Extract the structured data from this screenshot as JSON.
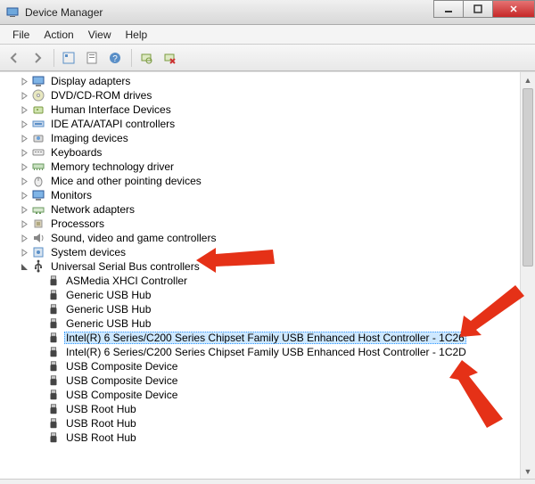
{
  "window": {
    "title": "Device Manager"
  },
  "menu": {
    "file": "File",
    "action": "Action",
    "view": "View",
    "help": "Help"
  },
  "toolbar": {
    "back": "Back",
    "forward": "Forward",
    "up": "Show hidden",
    "console": "Console tree",
    "properties": "Properties",
    "help": "Help",
    "scan": "Scan for hardware changes",
    "uninstall": "Uninstall"
  },
  "tree": {
    "categories": [
      {
        "name": "Display adapters",
        "icon": "monitor",
        "expanded": false
      },
      {
        "name": "DVD/CD-ROM drives",
        "icon": "disc",
        "expanded": false
      },
      {
        "name": "Human Interface Devices",
        "icon": "hid",
        "expanded": false
      },
      {
        "name": "IDE ATA/ATAPI controllers",
        "icon": "ide",
        "expanded": false
      },
      {
        "name": "Imaging devices",
        "icon": "camera",
        "expanded": false
      },
      {
        "name": "Keyboards",
        "icon": "keyboard",
        "expanded": false
      },
      {
        "name": "Memory technology driver",
        "icon": "memory",
        "expanded": false
      },
      {
        "name": "Mice and other pointing devices",
        "icon": "mouse",
        "expanded": false
      },
      {
        "name": "Monitors",
        "icon": "monitor",
        "expanded": false
      },
      {
        "name": "Network adapters",
        "icon": "network",
        "expanded": false
      },
      {
        "name": "Processors",
        "icon": "cpu",
        "expanded": false
      },
      {
        "name": "Sound, video and game controllers",
        "icon": "sound",
        "expanded": false
      },
      {
        "name": "System devices",
        "icon": "system",
        "expanded": false
      },
      {
        "name": "Universal Serial Bus controllers",
        "icon": "usb",
        "expanded": true
      }
    ],
    "usb_children": [
      {
        "name": "ASMedia XHCI Controller"
      },
      {
        "name": "Generic USB Hub"
      },
      {
        "name": "Generic USB Hub"
      },
      {
        "name": "Generic USB Hub"
      },
      {
        "name": "Intel(R) 6 Series/C200 Series Chipset Family USB Enhanced Host Controller - 1C26",
        "selected": true
      },
      {
        "name": "Intel(R) 6 Series/C200 Series Chipset Family USB Enhanced Host Controller - 1C2D"
      },
      {
        "name": "USB Composite Device"
      },
      {
        "name": "USB Composite Device"
      },
      {
        "name": "USB Composite Device"
      },
      {
        "name": "USB Root Hub"
      },
      {
        "name": "USB Root Hub"
      },
      {
        "name": "USB Root Hub"
      }
    ]
  },
  "annotations": {
    "arrow_target_category": "Universal Serial Bus controllers",
    "arrow_target_item_1": "Intel(R) 6 Series/C200 Series Chipset Family USB Enhanced Host Controller - 1C26",
    "arrow_target_item_2": "Intel(R) 6 Series/C200 Series Chipset Family USB Enhanced Host Controller - 1C2D"
  }
}
